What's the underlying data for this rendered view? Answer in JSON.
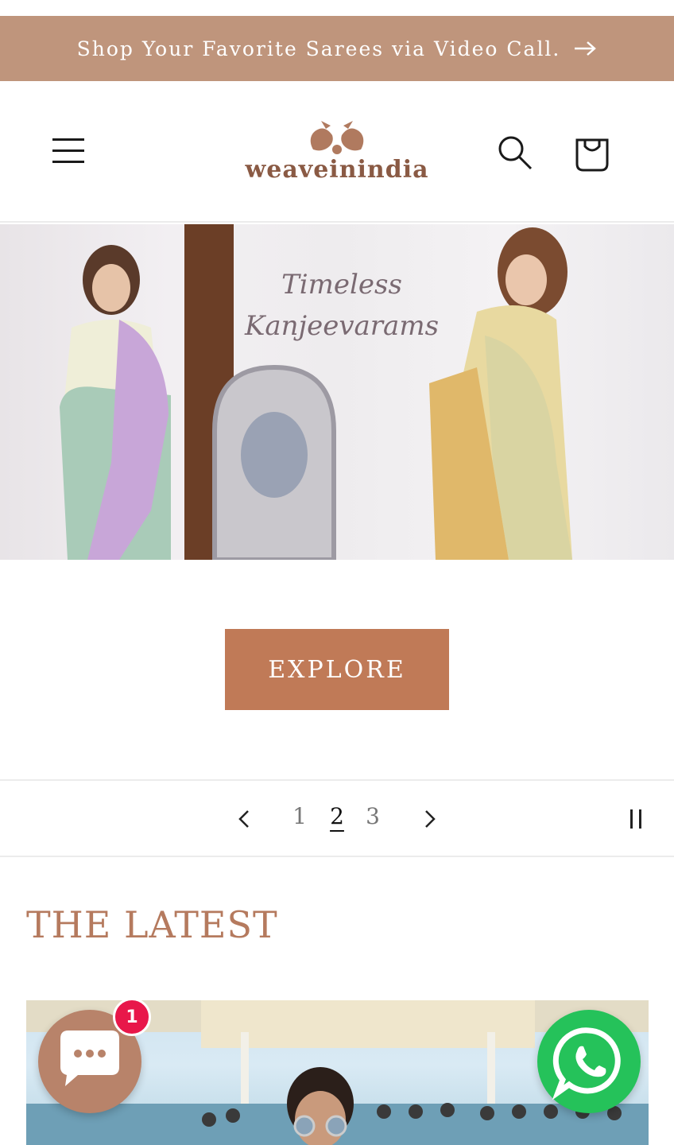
{
  "announcement": {
    "text": "Shop Your Favorite Sarees via Video Call.",
    "arrow_icon": "arrow-right-icon"
  },
  "header": {
    "logo_text": "weaveinindia",
    "menu_icon": "hamburger-icon",
    "search_icon": "search-icon",
    "cart_icon": "cart-icon"
  },
  "hero": {
    "script_line1": "Timeless",
    "script_line2": "Kanjeevarams",
    "button_label": "EXPLORE"
  },
  "slider": {
    "pages": [
      "1",
      "2",
      "3"
    ],
    "active_page": "2",
    "prev_icon": "chevron-left-icon",
    "next_icon": "chevron-right-icon",
    "pause_icon": "pause-icon"
  },
  "latest": {
    "title": "THE LATEST"
  },
  "floating": {
    "chat_badge": "1",
    "chat_icon": "chat-bubble-icon",
    "whatsapp_icon": "whatsapp-icon"
  },
  "colors": {
    "announcement_bg": "#bf957c",
    "button_bg": "#c07a57",
    "title_color": "#b57a5e",
    "chat_bg": "#b8836a",
    "whatsapp_bg": "#25c25a",
    "badge_bg": "#e8174a"
  }
}
